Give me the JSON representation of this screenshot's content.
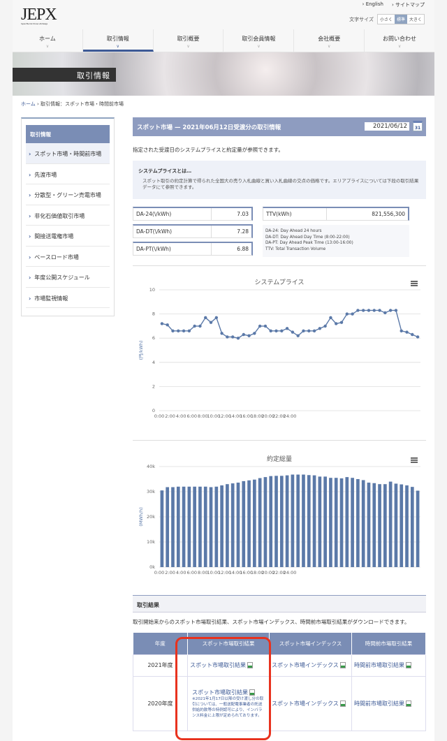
{
  "header": {
    "logo": "JEPX",
    "logo_sub": "Japan Electric Power eXchange",
    "links": [
      "English",
      "サイトマップ"
    ],
    "font_size_label": "文字サイズ",
    "font_sizes": [
      "小さく",
      "標準",
      "大きく"
    ]
  },
  "nav": [
    {
      "label": "ホーム"
    },
    {
      "label": "取引情報"
    },
    {
      "label": "取引概要"
    },
    {
      "label": "取引会員情報"
    },
    {
      "label": "会社概要"
    },
    {
      "label": "お問い合わせ"
    }
  ],
  "banner": {
    "title": "取引情報"
  },
  "breadcrumb": {
    "home": "ホーム",
    "current": " › 取引情報：スポット市場・時間前市場"
  },
  "sidebar": {
    "head": "取引情報",
    "items": [
      "スポット市場・時間前市場",
      "先渡市場",
      "分散型・グリーン売電市場",
      "非化石価値取引市場",
      "間接送電権市場",
      "ベースロード市場",
      "年度公開スケジュール",
      "市場監視情報"
    ]
  },
  "main": {
    "title": "スポット市場 — 2021年06月12日受渡分の取引情報",
    "date": "2021/06/12",
    "cal": "31",
    "desc": "指定された受渡日のシステムプライスと約定量が参照できます。",
    "note_title": "システムプライスとは…",
    "note_text": "スポット取引の約定計算で得られた全国大の売り入札曲線と買い入札曲線の交点の価格です。エリアプライスについては下段の取引結果データにて参照できます。",
    "metrics": [
      {
        "label": "DA-24(\\/kWh)",
        "value": "7.03"
      },
      {
        "label": "DA-DT(\\/kWh)",
        "value": "7.28"
      },
      {
        "label": "DA-PT(\\/kWh)",
        "value": "6.88"
      }
    ],
    "ttv": {
      "label": "TTV(kWh)",
      "value": "821,556,300"
    },
    "legend": [
      "DA-24: Day Ahead 24 hours",
      "DA-DT: Day Ahead Day Time (8:00-22:00)",
      "DA-PT: Day Ahead Peak Time (13:00-16:00)",
      "TTV: Total Transaction Volume"
    ]
  },
  "chart_data": [
    {
      "type": "line",
      "title": "システムプライス",
      "ylabel": "(円/kWh)",
      "ylim": [
        0,
        10
      ],
      "yticks": [
        "0",
        "2",
        "4",
        "6",
        "8",
        "10"
      ],
      "xticks": [
        "0:00",
        "2:00",
        "4:00",
        "6:00",
        "8:00",
        "10:00",
        "12:00",
        "14:00",
        "16:00",
        "18:00",
        "20:00",
        "22:00",
        "24:00"
      ],
      "color": "#5b79a8",
      "values": [
        7.2,
        7.1,
        6.6,
        6.6,
        6.6,
        6.6,
        7.0,
        7.0,
        7.7,
        7.3,
        7.7,
        6.4,
        6.1,
        6.1,
        6.0,
        6.3,
        6.2,
        6.4,
        7.0,
        7.0,
        6.6,
        6.6,
        6.6,
        6.8,
        6.5,
        6.2,
        6.6,
        6.6,
        6.6,
        6.8,
        7.0,
        7.7,
        7.2,
        7.3,
        8.0,
        8.0,
        8.3,
        8.3,
        8.3,
        8.3,
        8.3,
        8.1,
        8.3,
        8.3,
        6.6,
        6.5,
        6.3,
        6.1
      ]
    },
    {
      "type": "bar",
      "title": "約定総量",
      "ylabel": "(MWh/h)",
      "ylim": [
        0,
        40000
      ],
      "yticks": [
        "0k",
        "10k",
        "20k",
        "30k",
        "40k"
      ],
      "xticks": [
        "0:00",
        "2:00",
        "4:00",
        "6:00",
        "8:00",
        "10:00",
        "12:00",
        "14:00",
        "16:00",
        "18:00",
        "20:00",
        "22:00",
        "24:00"
      ],
      "color": "#5b79a8",
      "values": [
        30500,
        31800,
        31800,
        32000,
        32000,
        32000,
        32000,
        32000,
        32000,
        31800,
        32000,
        32500,
        33000,
        33300,
        33600,
        34200,
        34500,
        34800,
        35400,
        35800,
        36200,
        36300,
        36300,
        36500,
        36800,
        36800,
        36800,
        36600,
        36500,
        36000,
        36000,
        35500,
        35500,
        35300,
        35800,
        35500,
        35000,
        34600,
        33600,
        33400,
        33000,
        33000,
        34000,
        33200,
        32900,
        32500,
        31900,
        30400
      ]
    }
  ],
  "results": {
    "title": "取引結果",
    "desc": "取引開始来からのスポット市場取引結果、スポット市場インデックス、時間前市場取引結果がダウンロードできます。",
    "headers": [
      "年度",
      "スポット市場取引結果",
      "スポット市場インデックス",
      "時間前市場取引結果"
    ],
    "rows": [
      {
        "year": "2021年度",
        "spot": "スポット市場取引結果",
        "index": "スポット市場インデックス",
        "intraday": "時間前市場取引結果"
      },
      {
        "year": "2020年度",
        "spot": "スポット市場取引結果",
        "note": "※2021年1月17日以降の受け渡し分の取引については、一般送配電事業者の託送供給約款等の特例認可により、インバランス料金に上限が定められております。",
        "index": "スポット市場インデックス",
        "intraday": "時間前市場取引結果"
      }
    ]
  }
}
